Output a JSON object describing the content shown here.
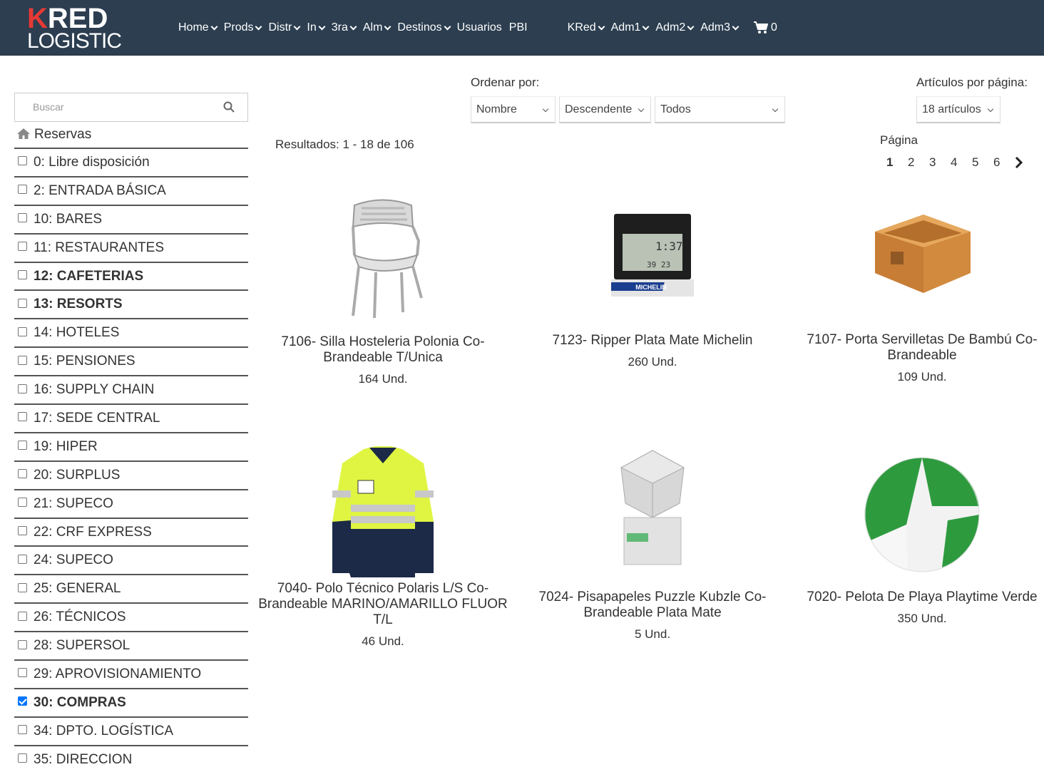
{
  "brand": {
    "logo_top_k": "K",
    "logo_top_rest": "RED",
    "logo_bottom": "LOGISTIC"
  },
  "nav": {
    "items": [
      {
        "label": "Home",
        "dropdown": true
      },
      {
        "label": "Prods",
        "dropdown": true
      },
      {
        "label": "Distr",
        "dropdown": true
      },
      {
        "label": "In",
        "dropdown": true
      },
      {
        "label": "3ra",
        "dropdown": true
      },
      {
        "label": "Alm",
        "dropdown": true
      },
      {
        "label": "Destinos",
        "dropdown": true
      },
      {
        "label": "Usuarios",
        "dropdown": false
      },
      {
        "label": "PBI",
        "dropdown": false
      }
    ],
    "items_right": [
      {
        "label": "KRed",
        "dropdown": true
      },
      {
        "label": "Adm1",
        "dropdown": true
      },
      {
        "label": "Adm2",
        "dropdown": true
      },
      {
        "label": "Adm3",
        "dropdown": true
      }
    ],
    "cart_count": "0",
    "cart_icon": "shopping-cart-icon"
  },
  "sidebar": {
    "search_placeholder": "Buscar",
    "header": "Reservas",
    "items": [
      {
        "label": "0: Libre disposición",
        "checked": false,
        "bold": false
      },
      {
        "label": "2: ENTRADA BÁSICA",
        "checked": false,
        "bold": false
      },
      {
        "label": "10: BARES",
        "checked": false,
        "bold": false
      },
      {
        "label": "11: RESTAURANTES",
        "checked": false,
        "bold": false
      },
      {
        "label": "12: CAFETERIAS",
        "checked": false,
        "bold": true
      },
      {
        "label": "13: RESORTS",
        "checked": false,
        "bold": true
      },
      {
        "label": "14: HOTELES",
        "checked": false,
        "bold": false
      },
      {
        "label": "15: PENSIONES",
        "checked": false,
        "bold": false
      },
      {
        "label": "16: SUPPLY CHAIN",
        "checked": false,
        "bold": false
      },
      {
        "label": "17: SEDE CENTRAL",
        "checked": false,
        "bold": false
      },
      {
        "label": "19: HIPER",
        "checked": false,
        "bold": false
      },
      {
        "label": "20: SURPLUS",
        "checked": false,
        "bold": false
      },
      {
        "label": "21: SUPECO",
        "checked": false,
        "bold": false
      },
      {
        "label": "22: CRF EXPRESS",
        "checked": false,
        "bold": false
      },
      {
        "label": "24: SUPECO",
        "checked": false,
        "bold": false
      },
      {
        "label": "25: GENERAL",
        "checked": false,
        "bold": false
      },
      {
        "label": "26: TÉCNICOS",
        "checked": false,
        "bold": false
      },
      {
        "label": "28: SUPERSOL",
        "checked": false,
        "bold": false
      },
      {
        "label": "29: APROVISIONAMIENTO",
        "checked": false,
        "bold": false
      },
      {
        "label": "30: COMPRAS",
        "checked": true,
        "bold": true
      },
      {
        "label": "34: DPTO. LOGÍSTICA",
        "checked": false,
        "bold": false
      },
      {
        "label": "35: DIRECCION",
        "checked": false,
        "bold": false
      }
    ]
  },
  "toolbar": {
    "order_label": "Ordenar por:",
    "sort_field": "Nombre",
    "sort_direction": "Descendente",
    "filter": "Todos",
    "per_page_label": "Artículos por página:",
    "per_page": "18 artículos"
  },
  "results_text": "Resultados: 1 - 18 de 106",
  "pagination": {
    "label": "Página",
    "pages": [
      "1",
      "2",
      "3",
      "4",
      "5",
      "6"
    ],
    "current": "1"
  },
  "products": [
    {
      "name": "7106- Silla Hosteleria Polonia Co-Brandeable T/Unica",
      "qty": "164 Und.",
      "image": "chair"
    },
    {
      "name": "7123- Ripper Plata Mate Michelin",
      "qty": "260 Und.",
      "image": "weather-station",
      "image_text": "MICHELIN"
    },
    {
      "name": "7107- Porta Servilletas De Bambú Co-Brandeable",
      "qty": "109 Und.",
      "image": "bamboo-box"
    },
    {
      "name": "7040- Polo Técnico Polaris L/S Co-Brandeable MARINO/AMARILLO FLUOR T/L",
      "qty": "46 Und.",
      "image": "polo-shirt"
    },
    {
      "name": "7024- Pisapapeles Puzzle Kubzle Co-Brandeable Plata Mate",
      "qty": "5 Und.",
      "image": "puzzle-cube"
    },
    {
      "name": "7020- Pelota De Playa Playtime Verde",
      "qty": "350 Und.",
      "image": "beach-ball"
    }
  ],
  "colors": {
    "navbar": "#2c3e50",
    "logo_accent": "#e53935",
    "checkbox": "#0075ff"
  }
}
